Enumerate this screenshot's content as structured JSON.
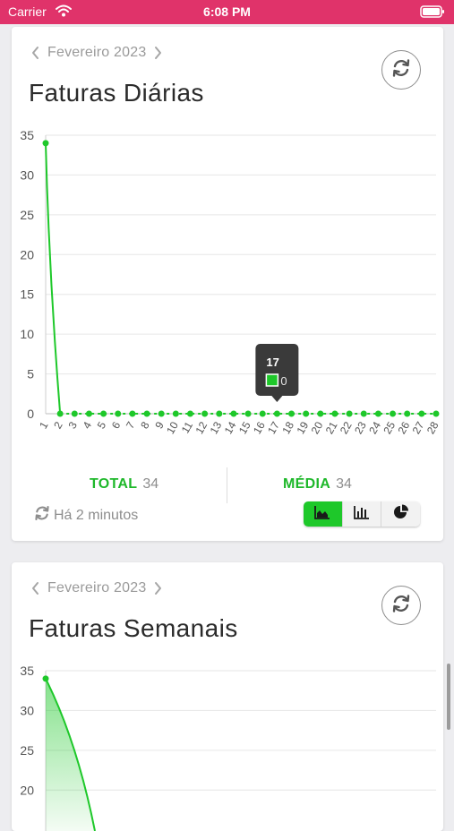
{
  "status_bar": {
    "carrier": "Carrier",
    "time": "6:08 PM"
  },
  "colors": {
    "accent_green": "#1ec82a",
    "status_bar_bg": "#e0336a",
    "tooltip_bg": "#3a3a3a"
  },
  "cards": [
    {
      "month": "Fevereiro 2023",
      "title": "Faturas Diárias",
      "totals": {
        "total_label": "TOTAL",
        "total_value": "34",
        "media_label": "MÉDIA",
        "media_value": "34"
      },
      "updated": "Há 2 minutos",
      "chart_toggle": {
        "options": [
          "area-chart-icon",
          "bar-chart-icon",
          "pie-chart-icon"
        ],
        "selected": "area-chart-icon"
      },
      "tooltip": {
        "title": "17",
        "value": "0"
      }
    },
    {
      "month": "Fevereiro 2023",
      "title": "Faturas Semanais"
    }
  ],
  "chart_data": [
    {
      "type": "line",
      "title": "Faturas Diárias",
      "x": [
        "1",
        "2",
        "3",
        "4",
        "5",
        "6",
        "7",
        "8",
        "9",
        "10",
        "11",
        "12",
        "13",
        "14",
        "15",
        "16",
        "17",
        "18",
        "19",
        "20",
        "21",
        "22",
        "23",
        "24",
        "25",
        "26",
        "27",
        "28"
      ],
      "series": [
        {
          "values": [
            34,
            0,
            0,
            0,
            0,
            0,
            0,
            0,
            0,
            0,
            0,
            0,
            0,
            0,
            0,
            0,
            0,
            0,
            0,
            0,
            0,
            0,
            0,
            0,
            0,
            0,
            0,
            0
          ]
        }
      ],
      "y_ticks": [
        0,
        5,
        10,
        15,
        20,
        25,
        30,
        35
      ],
      "ylim": [
        0,
        35
      ],
      "grid": true
    },
    {
      "type": "area",
      "title": "Faturas Semanais",
      "visible_y_ticks": [
        20,
        25,
        30,
        35
      ],
      "ylim": [
        0,
        35
      ],
      "first_value": 34,
      "grid": true
    }
  ]
}
